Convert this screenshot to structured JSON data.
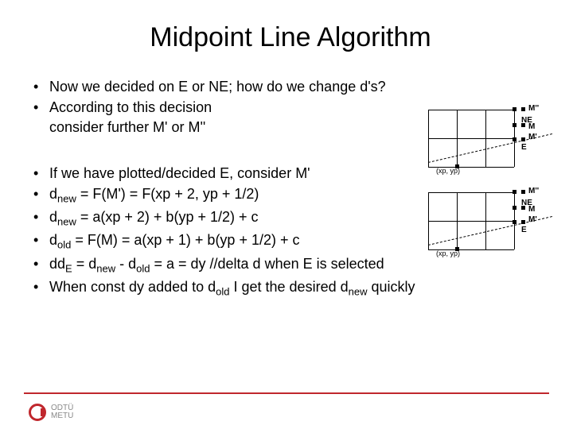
{
  "title": "Midpoint Line Algorithm",
  "bullets_a": [
    "Now we decided on E or NE; how do we change d's?",
    "According to this decision",
    "consider further M' or M''"
  ],
  "bullets_b": [
    {
      "pre": "If we have plotted/decided E, consider M'",
      "sub": ""
    },
    {
      "pre": "d",
      "sub": "new",
      "post": " = F(M') = F(xp + 2, yp + 1/2)"
    },
    {
      "pre": "d",
      "sub": "new",
      "post": " = a(xp + 2) + b(yp + 1/2) + c"
    },
    {
      "pre": "d",
      "sub": "old",
      "post": " = F(M) = a(xp + 1) + b(yp + 1/2) + c"
    },
    {
      "pre": "dd",
      "sub": "E",
      "post": " = d",
      "sub2": "new",
      "post2": " - d",
      "sub3": "old",
      "post3": " = a = dy //delta d when E is selected"
    },
    {
      "pre": "When const dy added to d",
      "sub": "old",
      "post": " I get the desired d",
      "sub2": "new",
      "post2": " quickly"
    }
  ],
  "diagram": {
    "labels": {
      "ne": "NE",
      "e": "E",
      "m": "M",
      "m1": "M'",
      "m2": "M''",
      "xp": "(xp, yp)"
    }
  },
  "logo": {
    "line1": "ODTÜ",
    "line2": "METU"
  }
}
